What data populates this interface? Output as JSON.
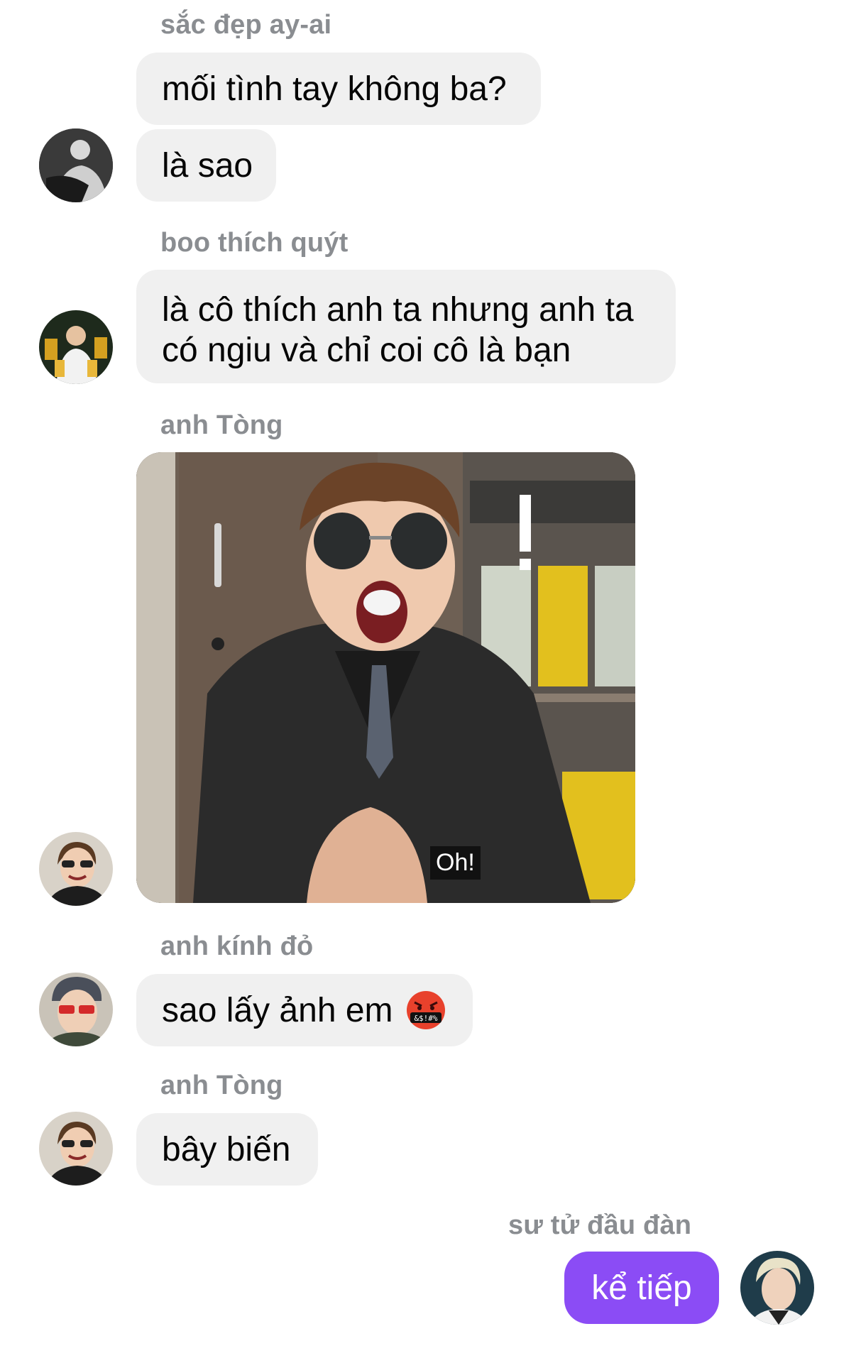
{
  "messages": [
    {
      "sender": "sắc đẹp ay-ai",
      "bubbles": [
        "mối tình tay không ba?",
        "là sao"
      ],
      "avatar_icon": "user-avatar-icon"
    },
    {
      "sender": "boo thích quýt",
      "bubbles": [
        "là cô thích anh ta nhưng anh ta có ngiu và chỉ coi cô là bạn"
      ],
      "avatar_icon": "user-avatar-icon"
    },
    {
      "sender": "anh Tòng",
      "photo_caption": "Oh!",
      "photo_mark": "!",
      "avatar_icon": "user-avatar-icon"
    },
    {
      "sender": "anh kính đỏ",
      "bubbles": [
        "sao lấy ảnh em"
      ],
      "emoji_text": "&$!#%",
      "avatar_icon": "user-avatar-icon"
    },
    {
      "sender": "anh Tòng",
      "bubbles": [
        "bây biến"
      ],
      "avatar_icon": "user-avatar-icon"
    },
    {
      "sender": "sư tử đầu đàn",
      "bubbles": [
        "kể tiếp"
      ],
      "avatar_icon": "user-avatar-icon",
      "outgoing": true
    }
  ],
  "colors": {
    "outgoing_bubble": "#8b4cf5",
    "incoming_bubble": "#f0f0f0",
    "sender_name": "#8a8d91"
  }
}
